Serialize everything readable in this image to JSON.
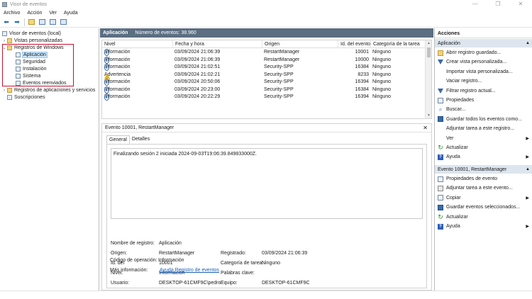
{
  "window": {
    "title": "Visor de eventos",
    "btn_min": "—",
    "btn_max": "❐",
    "btn_close": "✕"
  },
  "menu": [
    "Archivo",
    "Acción",
    "Ver",
    "Ayuda"
  ],
  "tree": {
    "root": "Visor de eventos (local)",
    "custom_views": "Vistas personalizadas",
    "windows_logs": "Registros de Windows",
    "logs": [
      "Aplicación",
      "Seguridad",
      "Instalación",
      "Sistema",
      "Eventos reenviados"
    ],
    "app_services": "Registros de aplicaciones y servicios",
    "subscriptions": "Suscripciones"
  },
  "center": {
    "title": "Aplicación",
    "count": "Número de eventos: 38.960",
    "columns": [
      "Nivel",
      "Fecha y hora",
      "Origen",
      "Id. del evento",
      "Categoría de la tarea"
    ],
    "rows": [
      {
        "level": "Información",
        "date": "03/09/2024 21:06:39",
        "source": "RestartManager",
        "id": "10001",
        "cat": "Ninguno",
        "warn": false
      },
      {
        "level": "Información",
        "date": "03/09/2024 21:06:39",
        "source": "RestartManager",
        "id": "10000",
        "cat": "Ninguno",
        "warn": false
      },
      {
        "level": "Información",
        "date": "03/09/2024 21:02:51",
        "source": "Security-SPP",
        "id": "16384",
        "cat": "Ninguno",
        "warn": false
      },
      {
        "level": "Advertencia",
        "date": "03/09/2024 21:02:21",
        "source": "Security-SPP",
        "id": "8233",
        "cat": "Ninguno",
        "warn": true
      },
      {
        "level": "Información",
        "date": "03/09/2024 20:50:06",
        "source": "Security-SPP",
        "id": "16394",
        "cat": "Ninguno",
        "warn": false
      },
      {
        "level": "Información",
        "date": "03/09/2024 20:23:00",
        "source": "Security-SPP",
        "id": "16384",
        "cat": "Ninguno",
        "warn": false
      },
      {
        "level": "Información",
        "date": "03/09/2024 20:22:29",
        "source": "Security-SPP",
        "id": "16394",
        "cat": "Ninguno",
        "warn": false
      }
    ]
  },
  "detail": {
    "title": "Evento 10001, RestartManager",
    "close": "✕",
    "tabs": [
      "General",
      "Detalles"
    ],
    "description": "Finalizando sesión 2 iniciada 2024-09-03T19:06:39.849833000Z.",
    "fields": {
      "log_name_label": "Nombre de registro:",
      "log_name": "Aplicación",
      "source_label": "Origen:",
      "source": "RestartManager",
      "logged_label": "Registrado:",
      "logged": "03/09/2024 21:06:39",
      "id_label": "Id. del",
      "id": "10001",
      "task_label": "Categoría de tarea:",
      "task": "Ninguno",
      "level_label": "Nivel:",
      "level": "Información",
      "keywords_label": "Palabras clave:",
      "user_label": "Usuario:",
      "user": "DESKTOP-61CMF9C\\pedro",
      "computer_label": "Equipo:",
      "computer": "DESKTOP-61CMF9C",
      "opcode_label": "Código de operación:",
      "opcode": "Información",
      "more_label": "Más información:",
      "more_link": "Ayuda Registro de eventos"
    }
  },
  "actions": {
    "header": "Acciones",
    "section1": "Aplicación",
    "items1": [
      "Abrir registro guardado...",
      "Crear vista personalizada...",
      "Importar vista personalizada...",
      "Vaciar registro...",
      "Filtrar registro actual...",
      "Propiedades",
      "Buscar...",
      "Guardar todos los eventos como...",
      "Adjuntar tarea a este registro...",
      "Ver",
      "Actualizar",
      "Ayuda"
    ],
    "section2": "Evento 10001, RestartManager",
    "items2": [
      "Propiedades de evento",
      "Adjuntar tarea a este evento...",
      "Copiar",
      "Guardar eventos seleccionados...",
      "Actualizar",
      "Ayuda"
    ],
    "up_caret": "▲"
  }
}
